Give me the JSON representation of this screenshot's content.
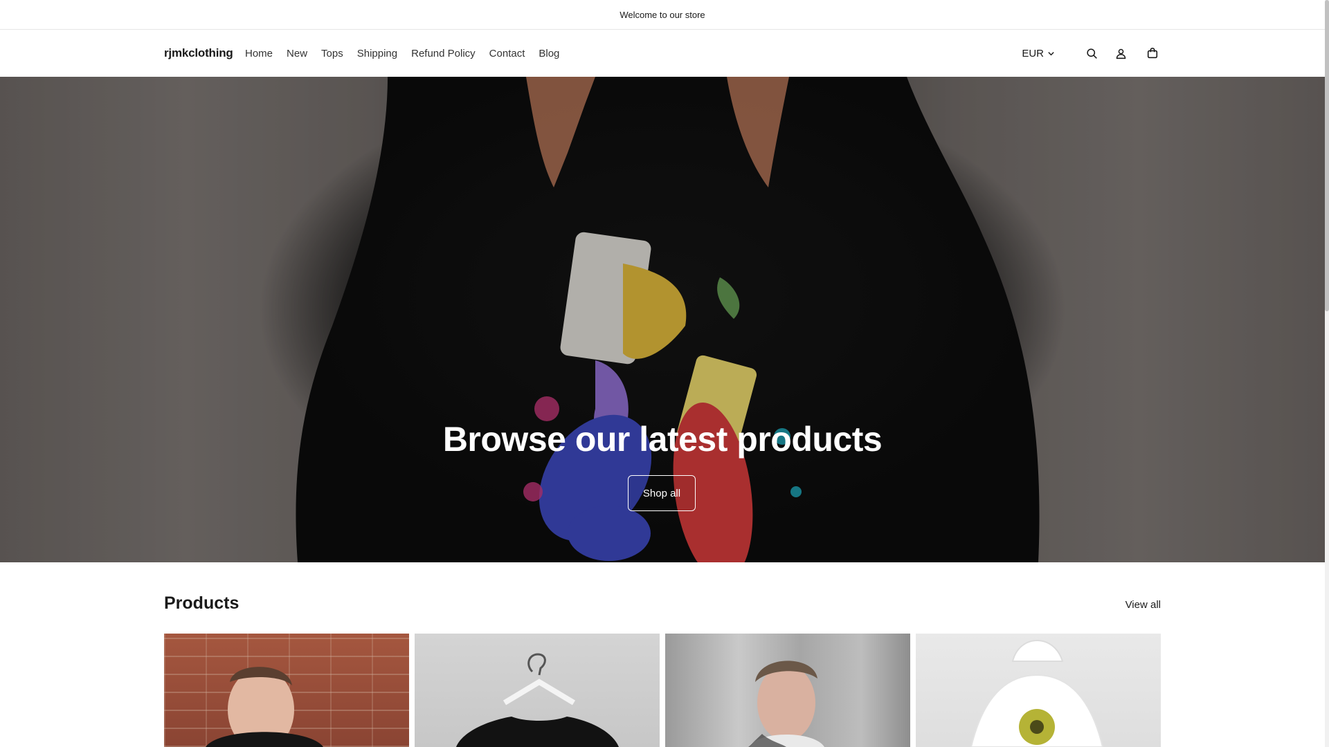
{
  "announcement": {
    "text": "Welcome to our store"
  },
  "header": {
    "logo": "rjmkclothing",
    "nav": [
      "Home",
      "New",
      "Tops",
      "Shipping",
      "Refund Policy",
      "Contact",
      "Blog"
    ],
    "currency": "EUR",
    "icons": [
      "search-icon",
      "account-icon",
      "cart-icon"
    ]
  },
  "hero": {
    "title": "Browse our latest products",
    "button_label": "Shop all"
  },
  "products": {
    "title": "Products",
    "view_all": "View all",
    "cards": [
      "product-image-1",
      "product-image-2",
      "product-image-3",
      "product-image-4"
    ]
  },
  "colors": {
    "text": "#1a1a1a",
    "hero_text": "#ffffff",
    "divider": "#e6e6e6"
  }
}
